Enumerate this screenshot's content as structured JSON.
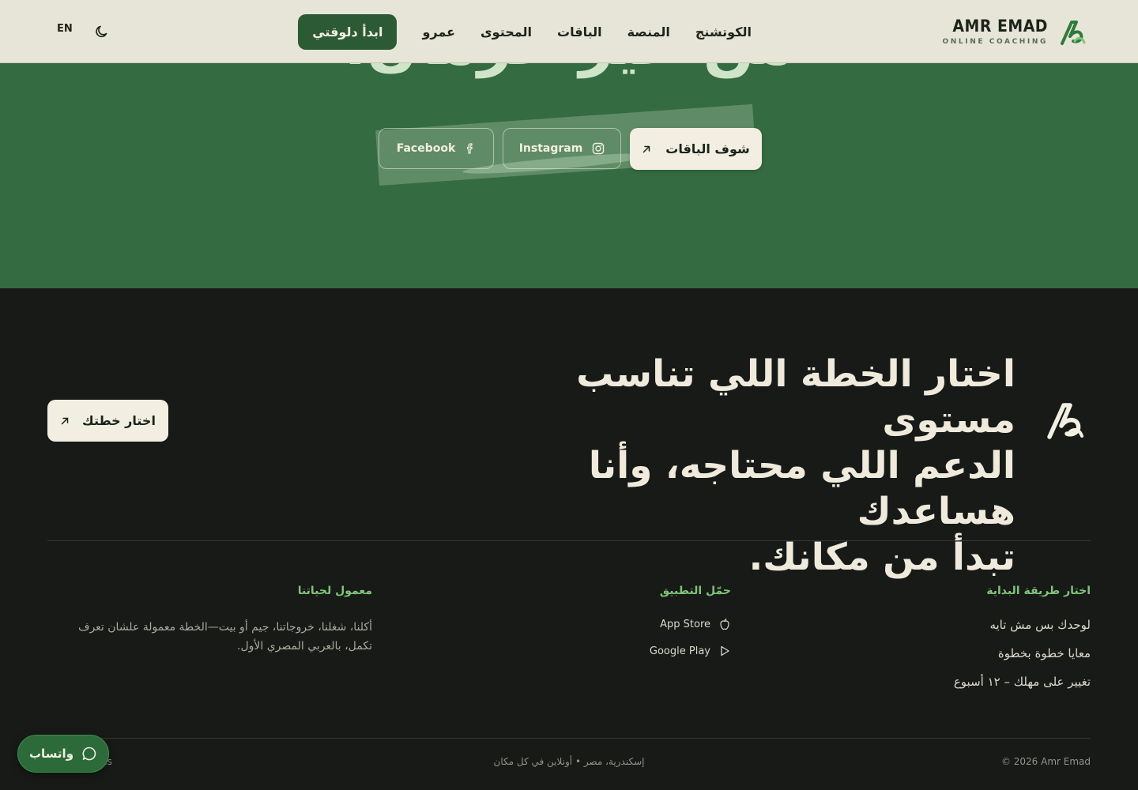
{
  "header": {
    "brand_name": "AMR EMAD",
    "brand_tagline": "ONLINE COACHING",
    "nav": [
      "الكوتشنج",
      "المنصة",
      "الباقات",
      "المحتوى",
      "عمرو"
    ],
    "start_button": "ابدأ دلوقتي",
    "lang_toggle": "EN",
    "icons": {
      "theme": "moon-icon",
      "logo": "brand-logo-icon"
    }
  },
  "hero": {
    "heading_fragment": "من غير حرمان.",
    "buttons": {
      "plans": "شوف الباقات",
      "instagram": "Instagram",
      "facebook": "Facebook"
    }
  },
  "cta": {
    "heading_lines": [
      "اختار الخطة اللي تناسب مستوى",
      "الدعم اللي محتاجه، وأنا هساعدك",
      "تبدأ من مكانك."
    ],
    "button": "اختار خطتك"
  },
  "footer": {
    "columns": {
      "start": {
        "title": "اختار طريقة البداية",
        "links": [
          "لوحدك بس مش تايه",
          "معايا خطوة بخطوة",
          "تغيير على مهلك – ١٢ أسبوع"
        ]
      },
      "app": {
        "title": "حمّل التطبيق",
        "links": [
          "App Store",
          "Google Play"
        ]
      },
      "about": {
        "title": "معمول لحياتنا",
        "text": "أكلنا، شغلنا، خروجاتنا، جيم أو بيت—الخطة معمولة علشان تعرف تكمل، بالعربي المصري الأول."
      }
    },
    "copyright": "© 2026 Amr Emad",
    "location": "إسكندرية، مصر • أونلاين في كل مكان",
    "terms_fragment": "ns"
  },
  "whatsapp": {
    "label": "واتساب"
  },
  "colors": {
    "header_bg": "#e7e5d8",
    "hero_green": "#356b40",
    "dark_bg": "#171a16",
    "accent_green": "#7fc47a",
    "button_green": "#2c5a35",
    "cream": "#f2eee2"
  }
}
